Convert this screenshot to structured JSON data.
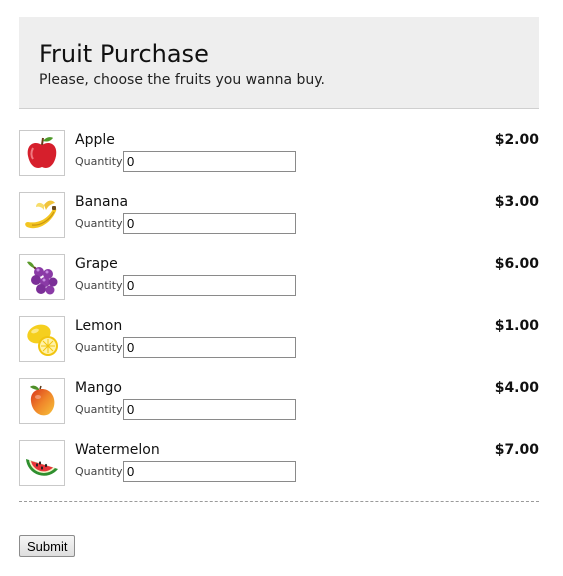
{
  "header": {
    "title": "Fruit Purchase",
    "subtitle": "Please, choose the fruits you wanna buy."
  },
  "quantity_label": "Quantity",
  "items": [
    {
      "name": "Apple",
      "price": "$2.00",
      "quantity": "0",
      "icon": "apple-icon"
    },
    {
      "name": "Banana",
      "price": "$3.00",
      "quantity": "0",
      "icon": "banana-icon"
    },
    {
      "name": "Grape",
      "price": "$6.00",
      "quantity": "0",
      "icon": "grape-icon"
    },
    {
      "name": "Lemon",
      "price": "$1.00",
      "quantity": "0",
      "icon": "lemon-icon"
    },
    {
      "name": "Mango",
      "price": "$4.00",
      "quantity": "0",
      "icon": "mango-icon"
    },
    {
      "name": "Watermelon",
      "price": "$7.00",
      "quantity": "0",
      "icon": "watermelon-icon"
    }
  ],
  "submit_label": "Submit"
}
